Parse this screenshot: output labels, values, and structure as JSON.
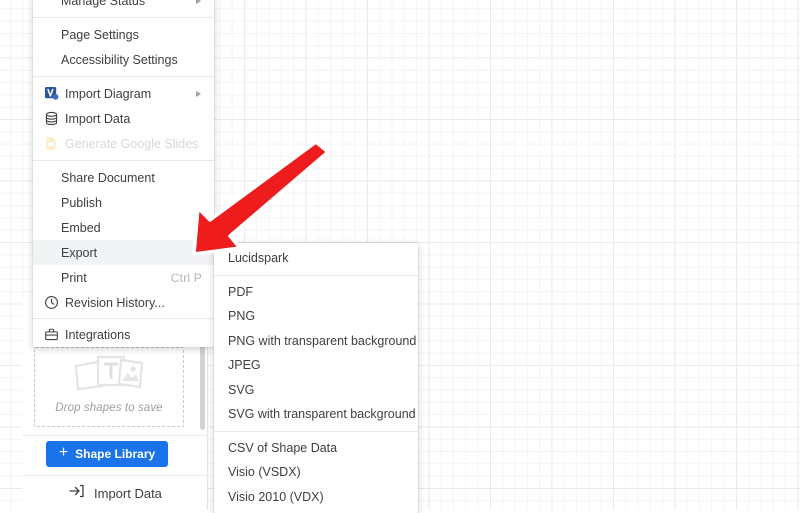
{
  "app": {
    "canvas_label": "diagram-canvas-grid"
  },
  "main_menu": {
    "groups": [
      {
        "items": [
          {
            "label": "Manage Status",
            "icon": null,
            "submenu_arrow": true,
            "disabled": false,
            "selected": false,
            "shortcut": null
          }
        ]
      },
      {
        "items": [
          {
            "label": "Page Settings",
            "icon": null,
            "submenu_arrow": false,
            "disabled": false,
            "selected": false,
            "shortcut": null
          },
          {
            "label": "Accessibility Settings",
            "icon": null,
            "submenu_arrow": false,
            "disabled": false,
            "selected": false,
            "shortcut": null
          }
        ]
      },
      {
        "items": [
          {
            "label": "Import Diagram",
            "icon": "visio-icon",
            "submenu_arrow": true,
            "disabled": false,
            "selected": false,
            "shortcut": null
          },
          {
            "label": "Import Data",
            "icon": "database-icon",
            "submenu_arrow": false,
            "disabled": false,
            "selected": false,
            "shortcut": null
          },
          {
            "label": "Generate Google Slides",
            "icon": "google-slides-icon",
            "submenu_arrow": false,
            "disabled": true,
            "selected": false,
            "shortcut": null
          }
        ]
      },
      {
        "items": [
          {
            "label": "Share Document",
            "icon": null,
            "submenu_arrow": false,
            "disabled": false,
            "selected": false,
            "shortcut": null
          },
          {
            "label": "Publish",
            "icon": null,
            "submenu_arrow": false,
            "disabled": false,
            "selected": false,
            "shortcut": null
          },
          {
            "label": "Embed",
            "icon": null,
            "submenu_arrow": false,
            "disabled": false,
            "selected": false,
            "shortcut": null
          },
          {
            "label": "Export",
            "icon": null,
            "submenu_arrow": true,
            "disabled": false,
            "selected": true,
            "shortcut": null
          },
          {
            "label": "Print",
            "icon": null,
            "submenu_arrow": false,
            "disabled": false,
            "selected": false,
            "shortcut": "Ctrl P"
          },
          {
            "label": "Revision History...",
            "icon": "clock-icon",
            "submenu_arrow": false,
            "disabled": false,
            "selected": false,
            "shortcut": null
          }
        ]
      },
      {
        "items": [
          {
            "label": "Integrations",
            "icon": "briefcase-icon",
            "submenu_arrow": false,
            "disabled": false,
            "selected": false,
            "shortcut": null
          }
        ]
      }
    ]
  },
  "export_submenu": {
    "groups": [
      {
        "items": [
          {
            "label": "Lucidspark"
          }
        ]
      },
      {
        "items": [
          {
            "label": "PDF"
          },
          {
            "label": "PNG"
          },
          {
            "label": "PNG with transparent background"
          },
          {
            "label": "JPEG"
          },
          {
            "label": "SVG"
          },
          {
            "label": "SVG with transparent background"
          }
        ]
      },
      {
        "items": [
          {
            "label": "CSV of Shape Data"
          },
          {
            "label": "Visio (VSDX)"
          },
          {
            "label": "Visio 2010 (VDX)"
          }
        ]
      }
    ]
  },
  "shape_panel": {
    "drop_zone_label": "Drop shapes to save",
    "drop_zone_icon": "shape-cards-icon",
    "shape_library_button": {
      "label": "Shape Library",
      "plus": "+",
      "color": "#1a73e8"
    },
    "import_data": {
      "label": "Import Data",
      "icon": "import-arrow-icon"
    }
  },
  "annotation": {
    "arrow_color": "#ee1c1c",
    "arrow_outline": "#ffffff",
    "name": "red-pointer-arrow"
  }
}
